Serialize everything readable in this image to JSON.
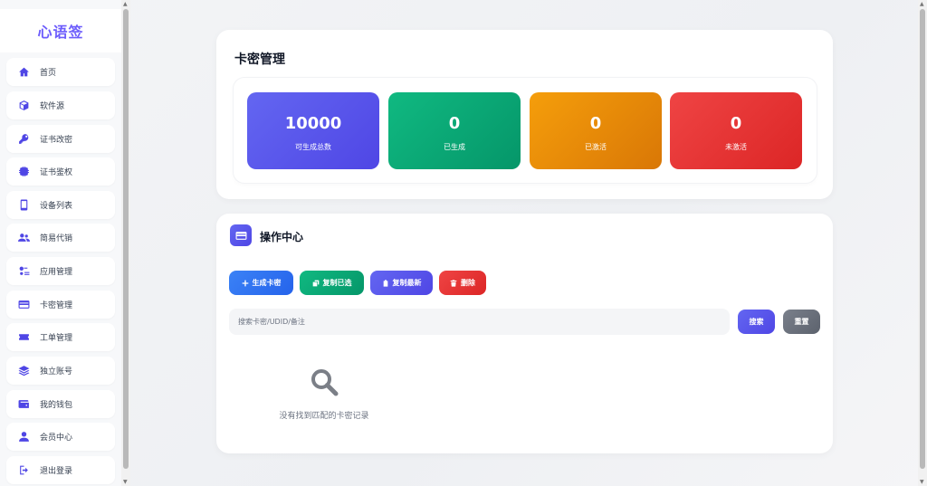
{
  "app": {
    "logo": "心语签"
  },
  "sidebar": {
    "items": [
      {
        "label": "首页",
        "icon": "home-icon"
      },
      {
        "label": "软件源",
        "icon": "box-icon"
      },
      {
        "label": "证书改密",
        "icon": "key-icon"
      },
      {
        "label": "证书鉴权",
        "icon": "chip-icon"
      },
      {
        "label": "设备列表",
        "icon": "phone-icon"
      },
      {
        "label": "简易代销",
        "icon": "users-icon"
      },
      {
        "label": "应用管理",
        "icon": "apps-icon"
      },
      {
        "label": "卡密管理",
        "icon": "card-icon"
      },
      {
        "label": "工单管理",
        "icon": "ticket-icon"
      },
      {
        "label": "独立账号",
        "icon": "layers-icon"
      },
      {
        "label": "我的钱包",
        "icon": "wallet-icon"
      },
      {
        "label": "会员中心",
        "icon": "user-icon"
      },
      {
        "label": "退出登录",
        "icon": "logout-icon"
      }
    ]
  },
  "card_management": {
    "title": "卡密管理",
    "stats": [
      {
        "value": "10000",
        "label": "可生成总数",
        "color": "#5b56e8"
      },
      {
        "value": "0",
        "label": "已生成",
        "color": "#0fa36f"
      },
      {
        "value": "0",
        "label": "已激活",
        "color": "#e2870b"
      },
      {
        "value": "0",
        "label": "未激活",
        "color": "#e53737"
      }
    ]
  },
  "operations": {
    "title": "操作中心",
    "buttons": {
      "generate": "生成卡密",
      "copy_selected": "复制已选",
      "copy_latest": "复制最新",
      "delete": "删除"
    },
    "search": {
      "placeholder": "搜索卡密/UDID/备注",
      "search_label": "搜索",
      "reset_label": "重置"
    },
    "empty_text": "没有找到匹配的卡密记录"
  },
  "colors": {
    "accent": "#6d5dfc",
    "blue": "#3b82f6",
    "green": "#10a36f",
    "indigo": "#5b56e8",
    "red": "#e53737",
    "gray": "#6b7280"
  }
}
